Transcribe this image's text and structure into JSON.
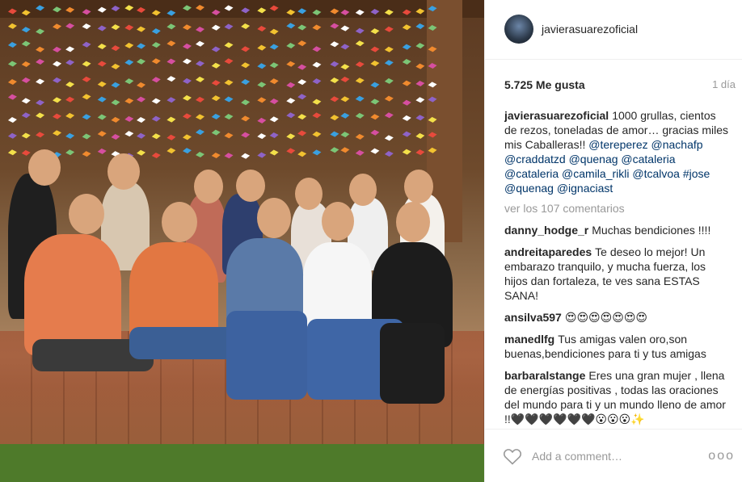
{
  "post": {
    "username": "javierasuarezoficial",
    "likes": "5.725 Me gusta",
    "age": "1 día",
    "caption_user": "javierasuarezoficial",
    "caption_text": "1000 grullas, cientos de rezos, toneladas de amor… gracias miles mis Caballeras!!",
    "caption_tags": [
      "@tereperez",
      "@nachafp",
      "@craddatzd",
      "@quenag",
      "@cataleria",
      "@cataleria",
      "@camila_rikli",
      "@tcalvoa",
      "#jose",
      "@quenag",
      "@ignaciast"
    ],
    "view_more": "ver los 107 comentarios"
  },
  "comments": [
    {
      "user": "danny_hodge_r",
      "text": "Muchas bendiciones !!!!"
    },
    {
      "user": "andreitaparedes",
      "text": "Te deseo lo mejor! Un embarazo tranquilo, y mucha fuerza, los hijos dan fortaleza, te ves sana ESTAS SANA!"
    },
    {
      "user": "ansilva597",
      "text": "😍😍😍😍😍😍😍"
    },
    {
      "user": "manedlfg",
      "text": "Tus amigas valen oro,son buenas,bendiciones para ti y tus amigas"
    },
    {
      "user": "barbaralstange",
      "text": "Eres una gran mujer , llena de energías positivas , todas las oraciones del mundo para ti y un mundo lleno de amor !!🖤🖤🖤🖤🖤🖤😮😮😮✨"
    }
  ],
  "add_comment_placeholder": "Add a comment…",
  "more_options": "ooo"
}
